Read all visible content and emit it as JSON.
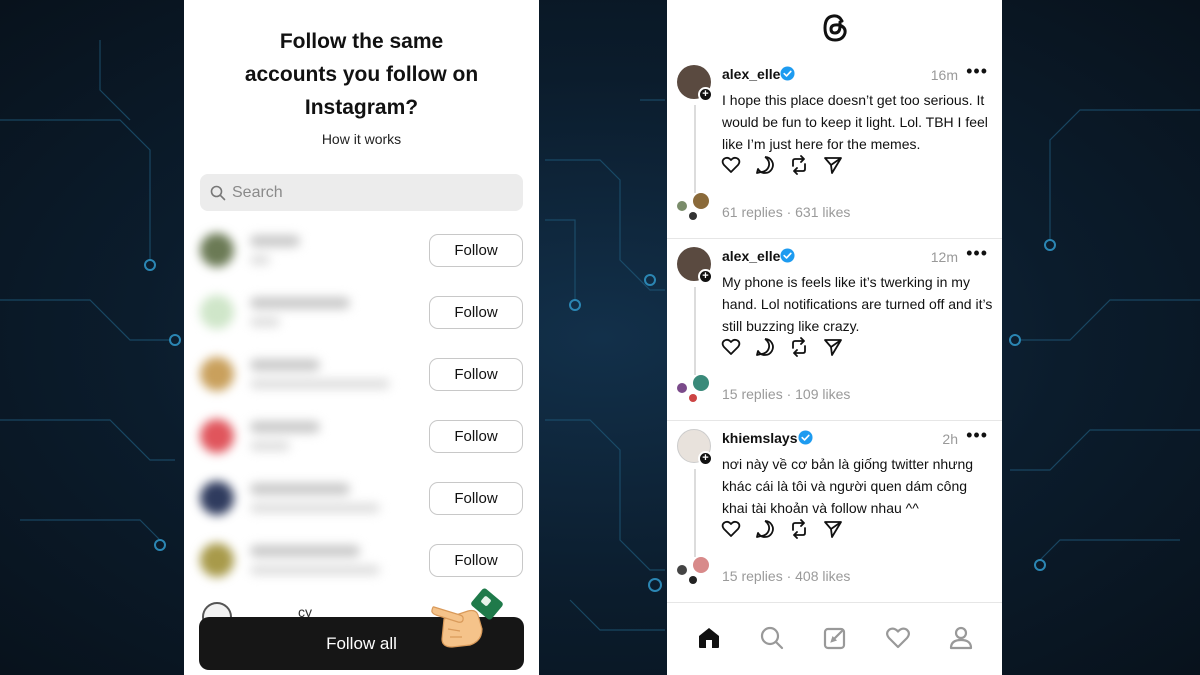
{
  "left_screen": {
    "title": "Follow the same accounts you follow on Instagram?",
    "subtitle": "How it works",
    "search": {
      "placeholder": "Search"
    },
    "accounts": [
      {
        "follow_label": "Follow",
        "avatar_color": "#6b7a55"
      },
      {
        "follow_label": "Follow",
        "avatar_color": "#cfe6c9"
      },
      {
        "follow_label": "Follow",
        "avatar_color": "#c9a05c"
      },
      {
        "follow_label": "Follow",
        "avatar_color": "#e0555c"
      },
      {
        "follow_label": "Follow",
        "avatar_color": "#2f3b5e"
      },
      {
        "follow_label": "Follow",
        "avatar_color": "#a89a4a"
      }
    ],
    "partial_account_name": "cy",
    "follow_all_label": "Follow all"
  },
  "right_screen": {
    "posts": [
      {
        "username": "alex_elle",
        "time": "16m",
        "text": "I hope this place doesn’t get too serious. It would be fun to keep it light. Lol. TBH I feel like I’m just here for the memes.",
        "stats": "61 replies · 631 likes",
        "avatar_color": "#5a4a40"
      },
      {
        "username": "alex_elle",
        "time": "12m",
        "text": "My phone is feels like it’s twerking in my hand. Lol notifications are turned off and it’s still buzzing like crazy.",
        "stats": "15 replies · 109 likes",
        "avatar_color": "#5a4a40"
      },
      {
        "username": "khiemslays",
        "time": "2h",
        "text": "nơi này về cơ bản là giống twitter nhưng khác cái là tôi và người quen dám công khai tài khoản và follow nhau ^^",
        "stats": "15 replies · 408 likes",
        "avatar_color": "#e8e2dc"
      }
    ],
    "more_label": "•••",
    "nav": [
      "home-icon",
      "search-icon",
      "compose-icon",
      "heart-icon",
      "profile-icon"
    ]
  },
  "colors": {
    "background": "#0a1826",
    "verified": "#1d9bf0",
    "follow_all_bg": "#161616"
  }
}
